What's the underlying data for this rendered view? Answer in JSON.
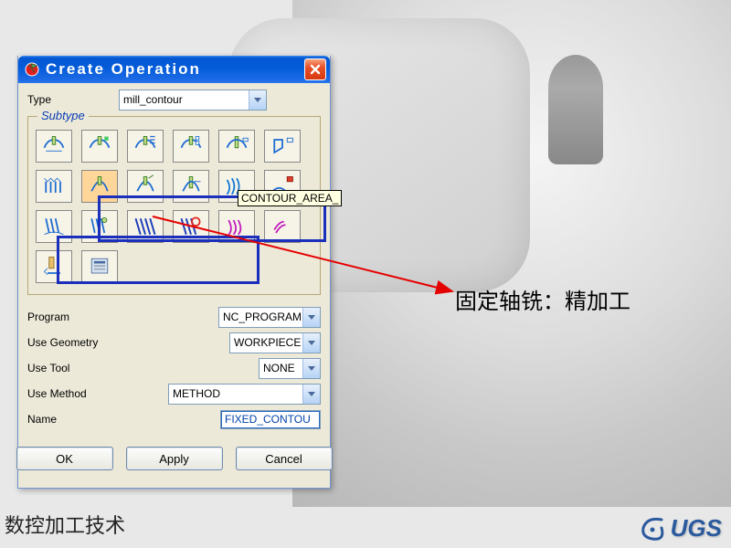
{
  "dialog": {
    "title": "Create Operation",
    "type_label": "Type",
    "type_value": "mill_contour",
    "subtype_label": "Subtype",
    "tooltip": "CONTOUR_AREA_",
    "program_label": "Program",
    "program_value": "NC_PROGRAM",
    "geometry_label": "Use Geometry",
    "geometry_value": "WORKPIECE",
    "tool_label": "Use Tool",
    "tool_value": "NONE",
    "method_label": "Use Method",
    "method_value": "METHOD",
    "name_label": "Name",
    "name_value": "FIXED_CONTOU",
    "ok": "OK",
    "apply": "Apply",
    "cancel": "Cancel"
  },
  "callout": "固定轴铣：精加工",
  "footer": "数控加工技术",
  "logo": "UGS"
}
